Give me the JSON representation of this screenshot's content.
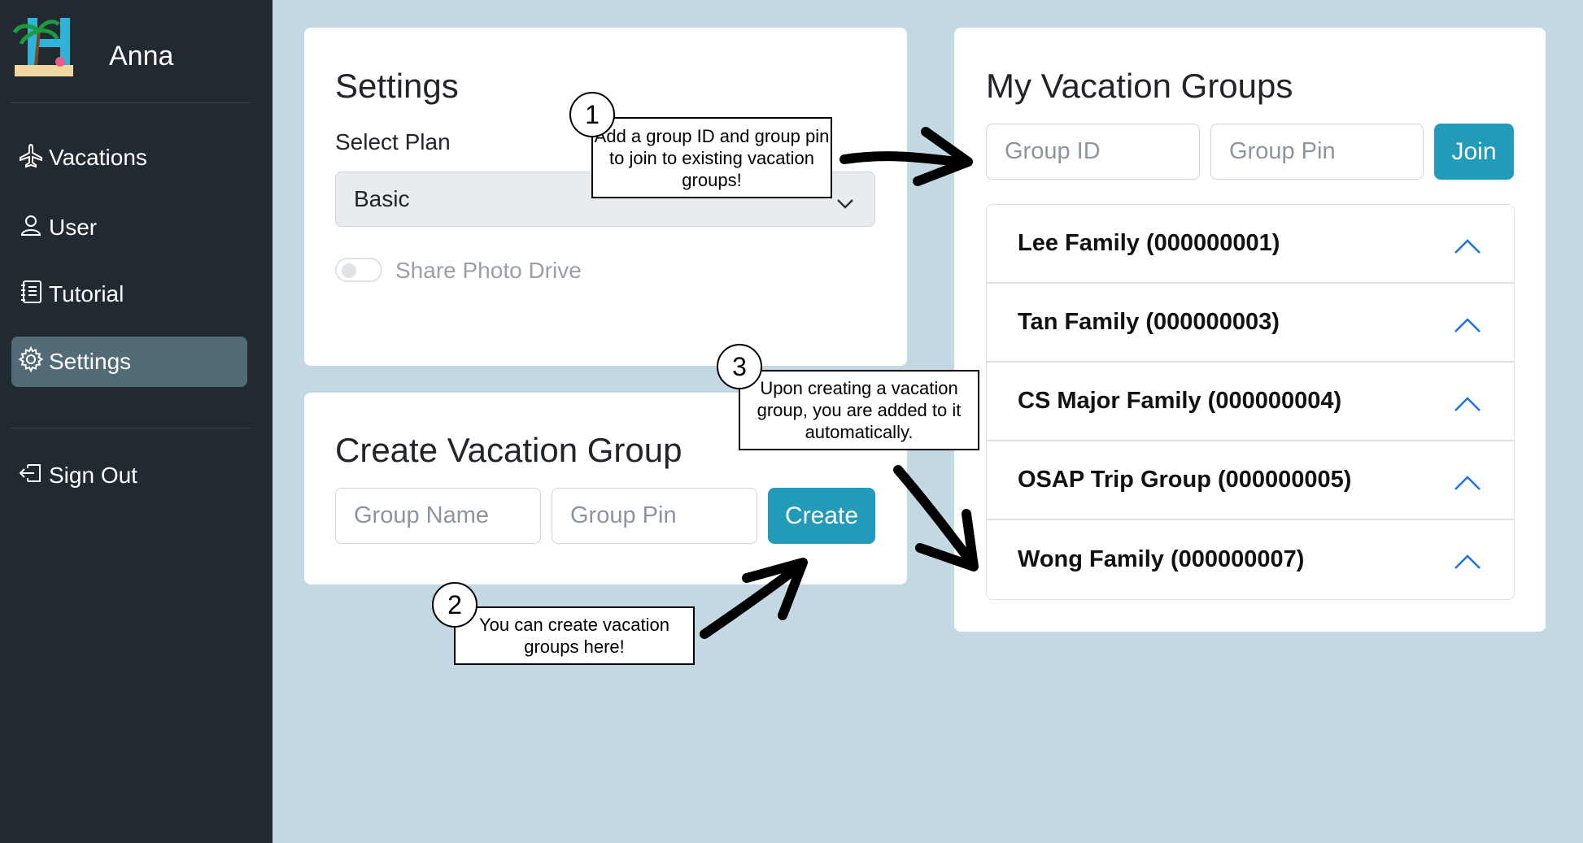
{
  "sidebar": {
    "user_name": "Anna",
    "items": [
      {
        "label": "Vacations",
        "icon": "airplane-icon"
      },
      {
        "label": "User",
        "icon": "person-icon"
      },
      {
        "label": "Tutorial",
        "icon": "journal-icon"
      },
      {
        "label": "Settings",
        "icon": "gear-icon",
        "active": true
      },
      {
        "label": "Sign Out",
        "icon": "sign-out-icon"
      }
    ]
  },
  "settings": {
    "title": "Settings",
    "select_plan_label": "Select Plan",
    "selected_plan": "Basic",
    "share_photo_drive_label": "Share Photo Drive",
    "share_photo_drive_enabled": false
  },
  "create_group": {
    "title": "Create Vacation Group",
    "group_name_placeholder": "Group Name",
    "group_pin_placeholder": "Group Pin",
    "create_label": "Create"
  },
  "my_groups": {
    "title": "My Vacation Groups",
    "group_id_placeholder": "Group ID",
    "group_pin_placeholder": "Group Pin",
    "join_label": "Join",
    "groups": [
      "Lee Family (000000001)",
      "Tan Family (000000003)",
      "CS Major Family (000000004)",
      "OSAP Trip Group (000000005)",
      "Wong Family (000000007)"
    ]
  },
  "annotations": [
    {
      "number": "1",
      "text": "Add a group ID and group pin to join to existing vacation groups!"
    },
    {
      "number": "2",
      "text": "You can create vacation groups here!"
    },
    {
      "number": "3",
      "text": "Upon creating a vacation group, you are added to it automatically."
    }
  ],
  "colors": {
    "sidebar_bg": "#212931",
    "active_item_bg": "#536a77",
    "page_bg": "#c3d8e2",
    "accent": "#219bb8",
    "chevron": "#1a73e8"
  }
}
